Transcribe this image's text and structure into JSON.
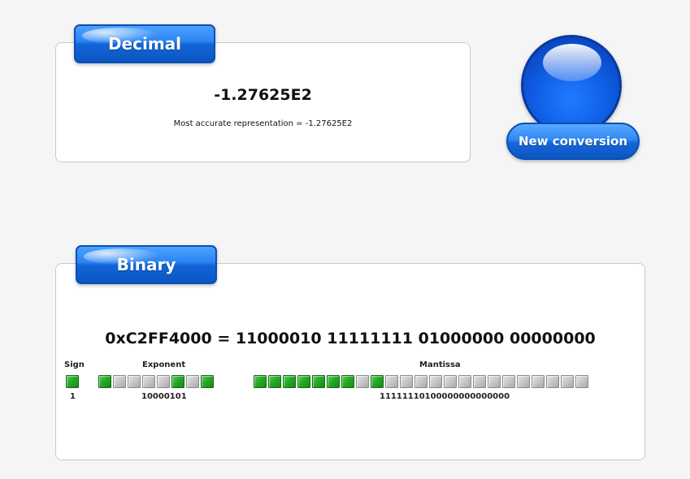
{
  "decimal": {
    "tab_label": "Decimal",
    "value": "-1.27625E2",
    "accurate_text": "Most accurate representation = -1.27625E2"
  },
  "new_conversion": {
    "label": "New conversion"
  },
  "binary": {
    "tab_label": "Binary",
    "hex_line": "0xC2FF4000 = 11000010 11111111 01000000 00000000",
    "sign": {
      "header": "Sign",
      "value": "1",
      "bits": [
        1
      ]
    },
    "exponent": {
      "header": "Exponent",
      "value": "10000101",
      "bits": [
        1,
        0,
        0,
        0,
        0,
        1,
        0,
        1
      ]
    },
    "mantissa": {
      "header": "Mantissa",
      "value": "11111110100000000000000",
      "bits": [
        1,
        1,
        1,
        1,
        1,
        1,
        1,
        0,
        1,
        0,
        0,
        0,
        0,
        0,
        0,
        0,
        0,
        0,
        0,
        0,
        0,
        0,
        0
      ]
    }
  },
  "colors": {
    "tab_blue": "#1264d8",
    "bit_on": "#29a829",
    "bit_off": "#c4c4c4"
  }
}
